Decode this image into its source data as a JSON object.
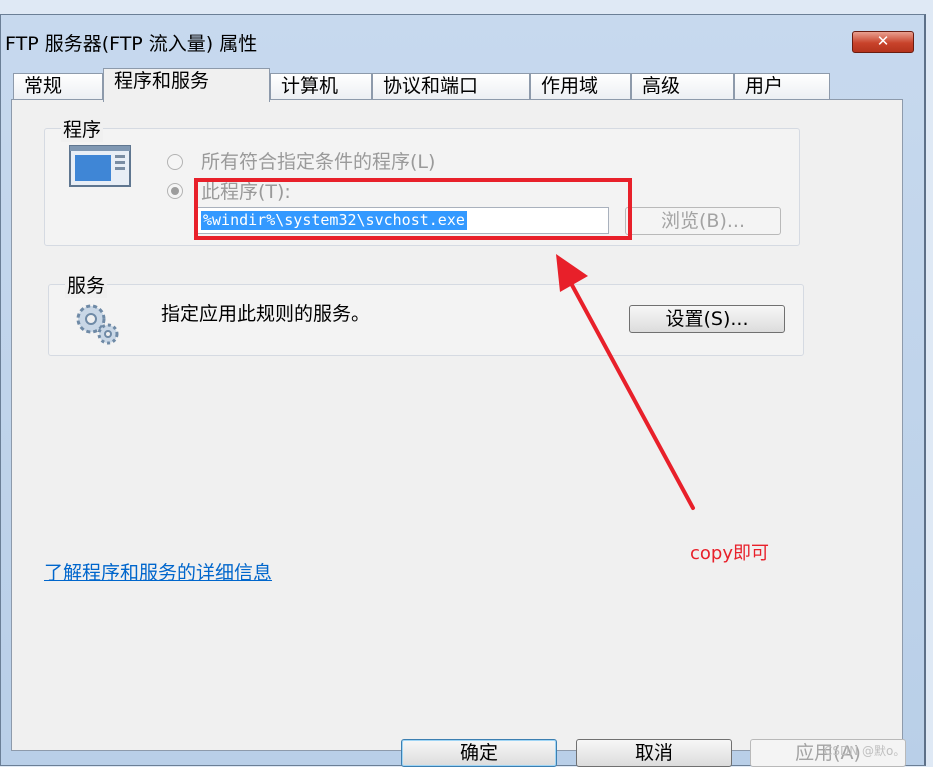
{
  "window": {
    "title": "FTP 服务器(FTP 流入量) 属性",
    "close_glyph": "✕"
  },
  "tabs": [
    {
      "label": "常规",
      "active": false
    },
    {
      "label": "程序和服务",
      "active": true
    },
    {
      "label": "计算机",
      "active": false
    },
    {
      "label": "协议和端口",
      "active": false
    },
    {
      "label": "作用域",
      "active": false
    },
    {
      "label": "高级",
      "active": false
    },
    {
      "label": "用户",
      "active": false
    }
  ],
  "programs": {
    "title": "程序",
    "icon": "program-window-icon",
    "option_all": "所有符合指定条件的程序(L)",
    "option_this": "此程序(T):",
    "path_value": "%windir%\\system32\\svchost.exe",
    "browse_label": "浏览(B)..."
  },
  "services": {
    "title": "服务",
    "icon": "gears-icon",
    "description": "指定应用此规则的服务。",
    "settings_label": "设置(S)..."
  },
  "help_link": "了解程序和服务的详细信息",
  "annotation": {
    "text": "copy即可",
    "color": "#e8202a"
  },
  "footer": {
    "ok_label": "确定",
    "cancel_label": "取消",
    "apply_label": "应用(A)"
  },
  "watermark": "CSDN @默o。"
}
